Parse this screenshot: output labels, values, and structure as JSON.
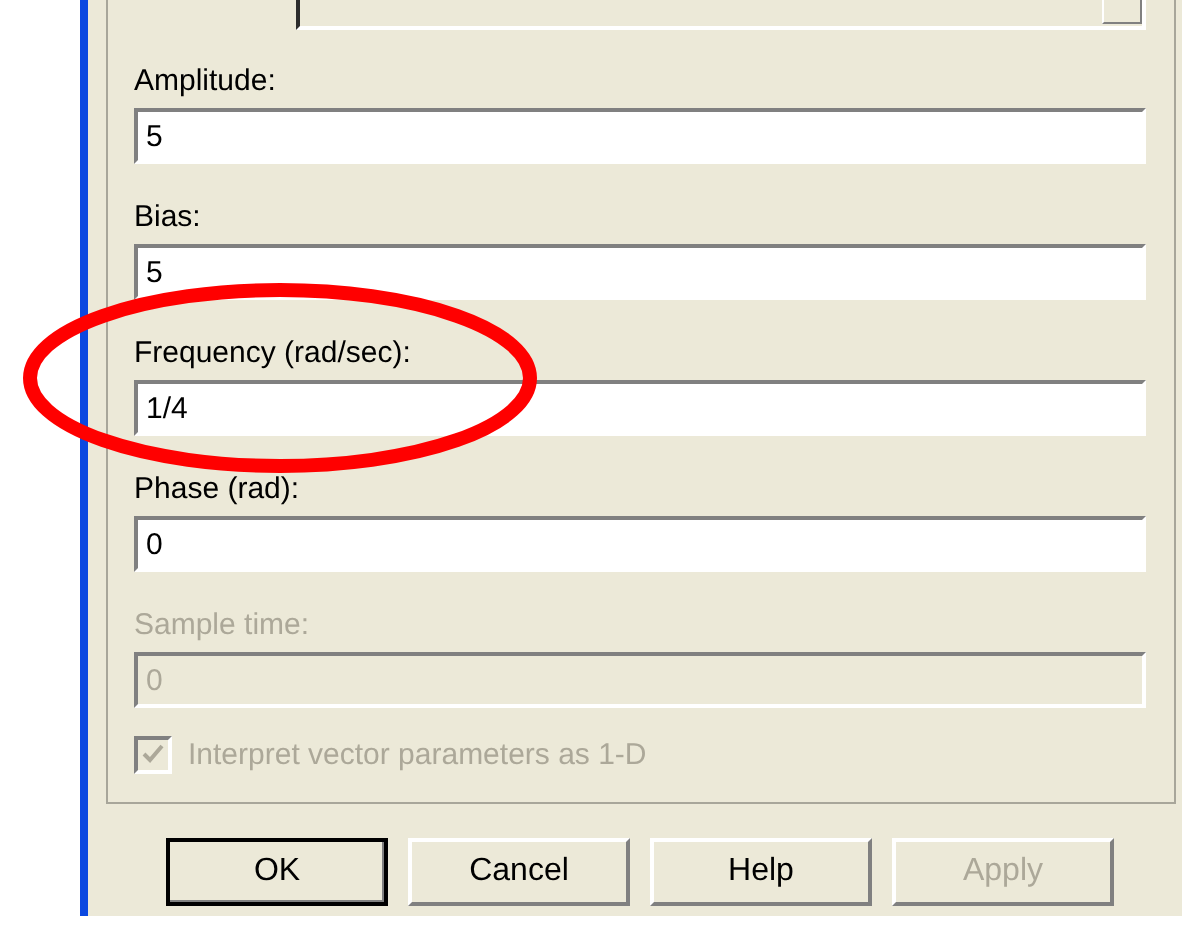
{
  "fields": [
    {
      "label": "Amplitude:",
      "value": "5",
      "disabled": false
    },
    {
      "label": "Bias:",
      "value": "5",
      "disabled": false
    },
    {
      "label": "Frequency (rad/sec):",
      "value": "1/4",
      "disabled": false
    },
    {
      "label": "Phase (rad):",
      "value": "0",
      "disabled": false
    },
    {
      "label": "Sample time:",
      "value": "0",
      "disabled": true
    }
  ],
  "checkbox": {
    "label": "Interpret vector parameters as 1-D",
    "checked": true,
    "disabled": true
  },
  "buttons": [
    {
      "label": "OK",
      "default": true,
      "disabled": false
    },
    {
      "label": "Cancel",
      "default": false,
      "disabled": false
    },
    {
      "label": "Help",
      "default": false,
      "disabled": false
    },
    {
      "label": "Apply",
      "default": false,
      "disabled": true
    }
  ],
  "annotation": {
    "kind": "ellipse"
  }
}
